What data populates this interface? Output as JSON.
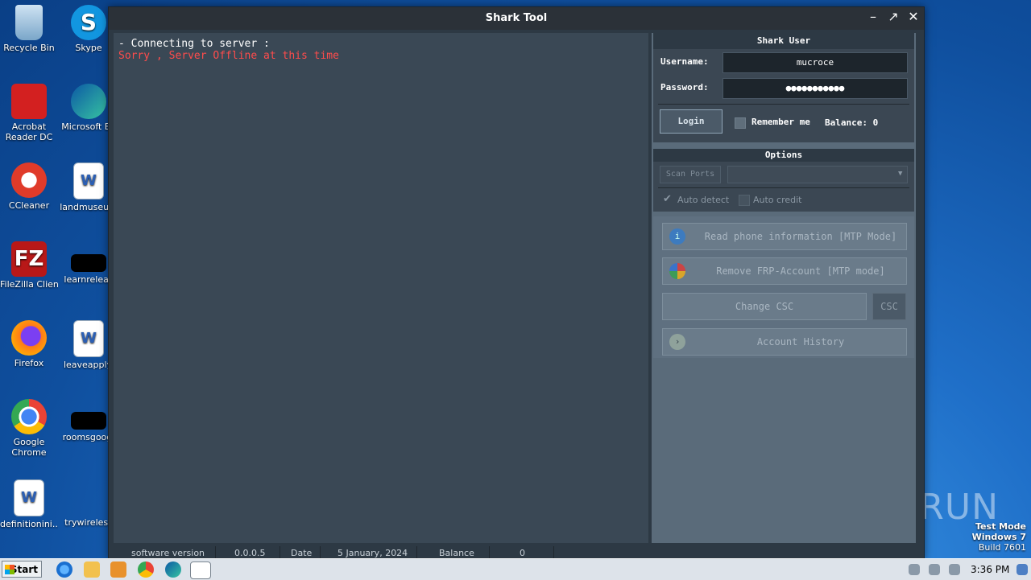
{
  "desktop": {
    "icons": [
      {
        "label": "Recycle Bin"
      },
      {
        "label": "Skype"
      },
      {
        "label": "Acrobat Reader DC"
      },
      {
        "label": "Microsoft Ed"
      },
      {
        "label": "CCleaner"
      },
      {
        "label": "landmuseum"
      },
      {
        "label": "FileZilla Client"
      },
      {
        "label": "learnreleas"
      },
      {
        "label": "Firefox"
      },
      {
        "label": "leaveapply."
      },
      {
        "label": "Google Chrome"
      },
      {
        "label": "roomsgoogl"
      },
      {
        "label": "definitionini..."
      },
      {
        "label": "trywireless"
      }
    ],
    "watermark": "ANY RUN",
    "test_mode": [
      "Test Mode",
      "Windows 7",
      "Build 7601"
    ]
  },
  "window": {
    "title": "Shark Tool",
    "minimize": "–",
    "maximize": "↗",
    "close": "✕"
  },
  "log": {
    "line1": "- Connecting to server :",
    "line2": "Sorry , Server Offline at this time"
  },
  "user_section": {
    "header": "Shark User",
    "username_label": "Username:",
    "username_value": "mucroce",
    "password_label": "Password:",
    "password_value": "●●●●●●●●●●●",
    "login_button": "Login",
    "remember_label": "Remember me",
    "balance_label": "Balance: 0"
  },
  "options_section": {
    "header": "Options",
    "scan_ports": "Scan Ports",
    "port_select": "",
    "auto_detect": "Auto detect",
    "auto_credit": "Auto credit"
  },
  "actions": {
    "read_phone": "Read phone information [MTP Mode]",
    "remove_frp": "Remove FRP-Account [MTP mode]",
    "change_csc": "Change CSC",
    "csc": "CSC",
    "account_history": "Account History"
  },
  "statusbar": {
    "software_version_label": "software version",
    "software_version": "0.0.0.5",
    "date_label": "Date",
    "date": "5 January, 2024",
    "balance_label": "Balance",
    "balance": "0"
  },
  "taskbar": {
    "start": "Start",
    "time": "3:36 PM"
  },
  "colors": {
    "log_bg": "#3a4855",
    "panel_bg": "#5a6b7a",
    "error_text": "#ff4c4c"
  }
}
